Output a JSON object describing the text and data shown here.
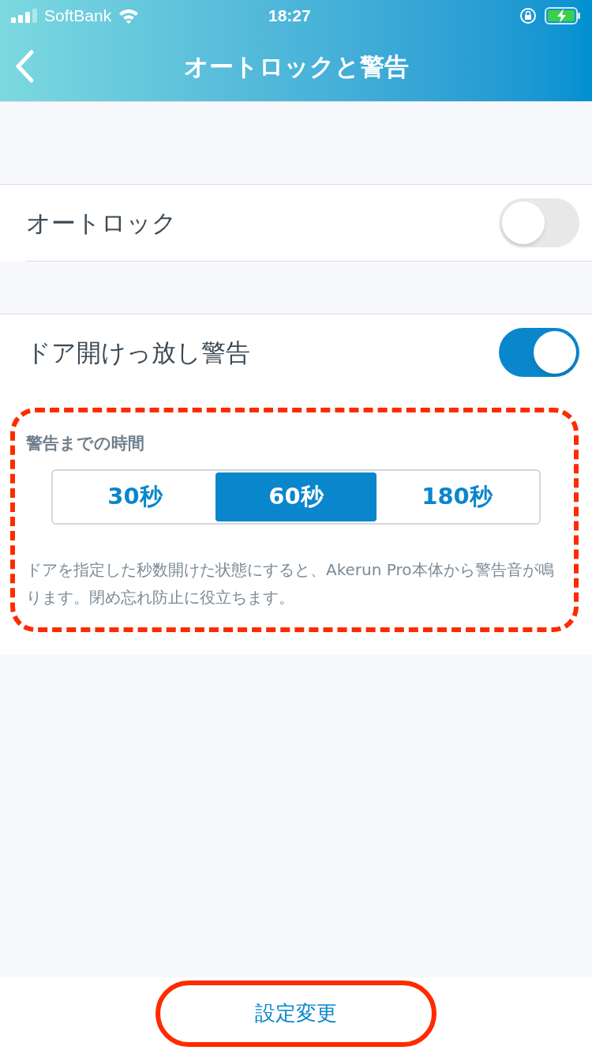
{
  "status_bar": {
    "carrier": "SoftBank",
    "time": "18:27"
  },
  "nav": {
    "title": "オートロックと警告"
  },
  "settings": [
    {
      "label": "オートロック",
      "on": false
    },
    {
      "label": "ドア開けっ放し警告",
      "on": true
    }
  ],
  "warning_time": {
    "label": "警告までの時間",
    "options": [
      {
        "label": "30秒",
        "selected": false
      },
      {
        "label": "60秒",
        "selected": true
      },
      {
        "label": "180秒",
        "selected": false
      }
    ],
    "description": "ドアを指定した秒数開けた状態にすると、Akerun Pro本体から警告音が鳴ります。閉め忘れ防止に役立ちます。"
  },
  "footer": {
    "button": "設定変更"
  }
}
